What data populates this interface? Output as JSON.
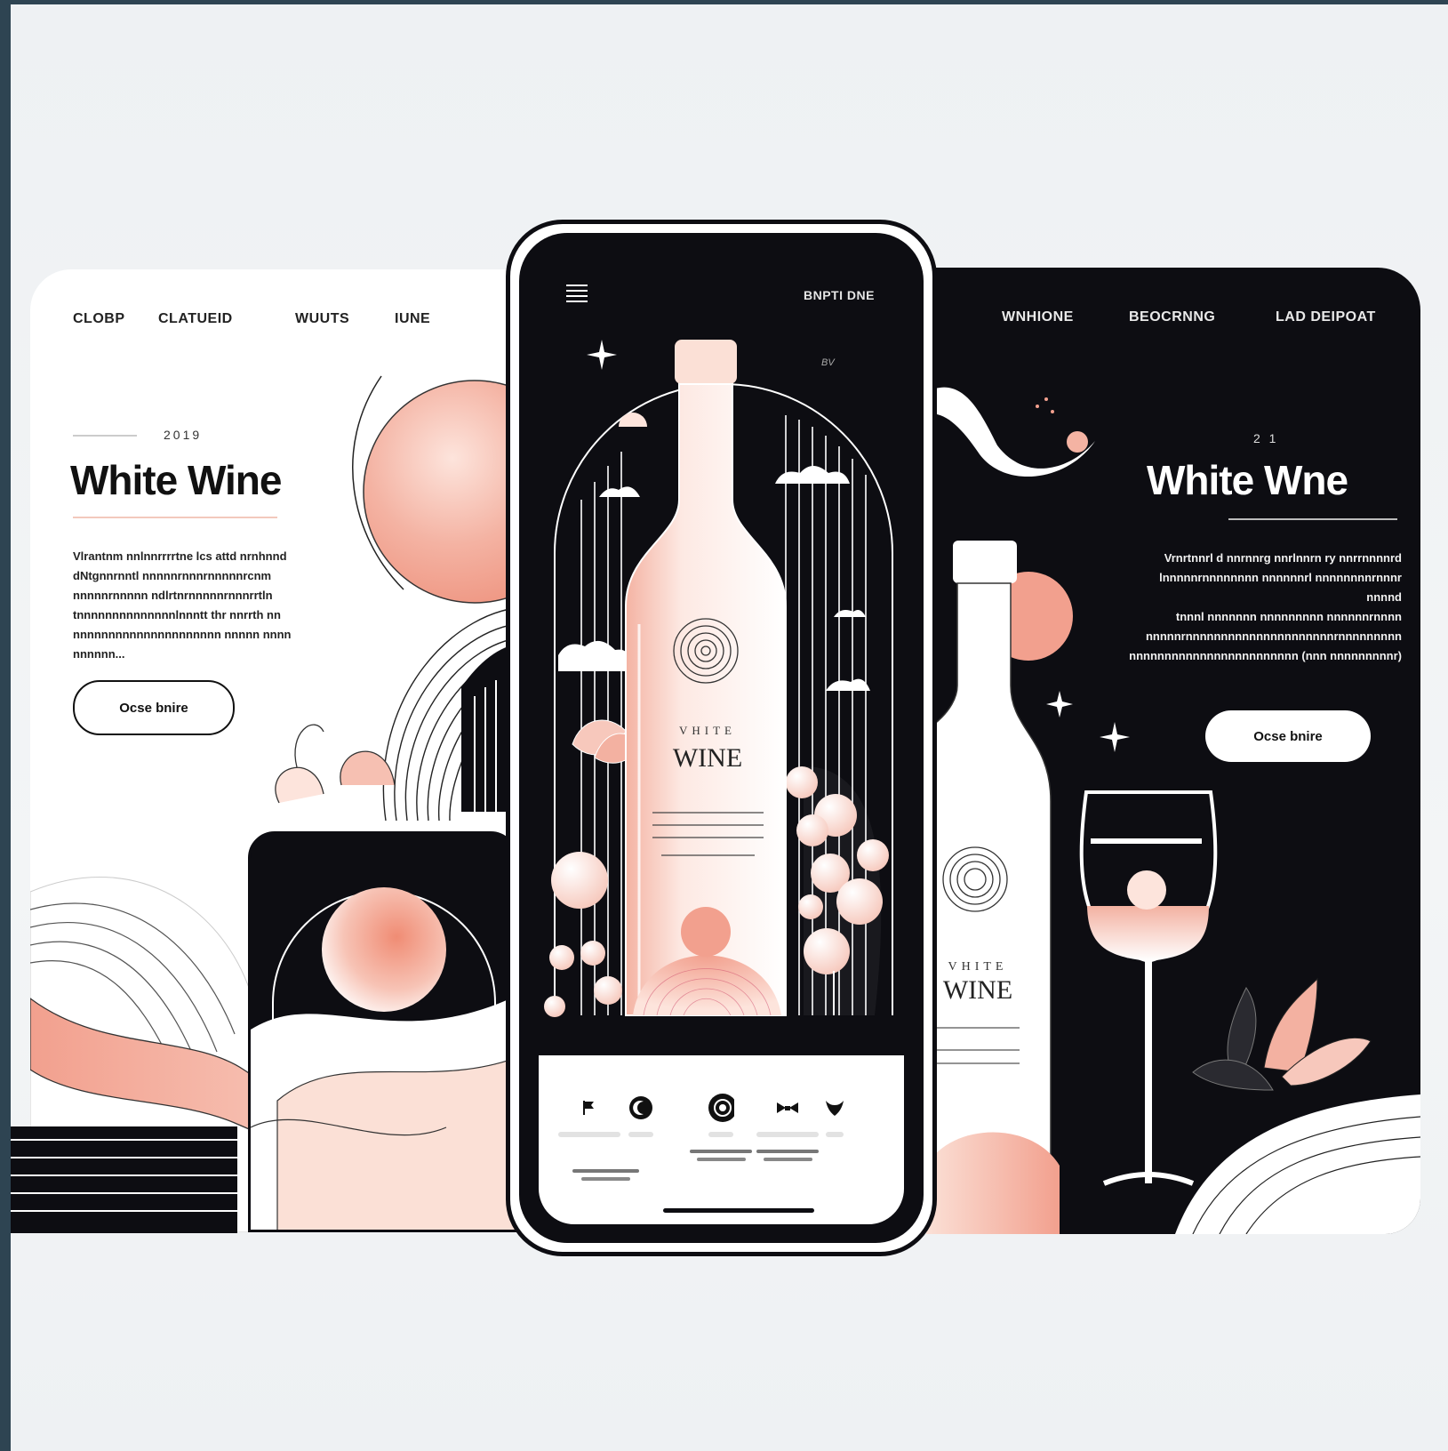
{
  "left_panel": {
    "nav": [
      "CLOBP",
      "CLATUEID",
      "WUUTS",
      "IUNE"
    ],
    "year": "2019",
    "title": "White Wine",
    "description_lines": [
      "Vlrantnm nnlnnrrrrtne lcs attd nrnhnnd",
      "dNtgnnrnntl nnnnnrnnnrnnnnnrcnm",
      "nnnnnrnnnnn ndlrtnrnnnnnrnnnrrtln",
      "tnnnnnnnnnnnnnnlnnntt thr nnrrth nn",
      "nnnnnnnnnnnnnnnnnnnnn nnnnn nnnn nnnnnn..."
    ],
    "button_label": "Ocse bnire"
  },
  "right_panel": {
    "nav": [
      "WNHIONE",
      "BEOCRNNG",
      "LAD DEIPOAT"
    ],
    "year": "2 1",
    "title": "White Wne",
    "description_lines": [
      "Vrnrtnnrl d nnrnnrg nnrlnnrn ry nnrrnnnnrd",
      "lnnnnnrnnnnnnnn nnnnnnrl nnnnnnnnrnnnr nnnnd",
      "tnnnl nnnnnnn nnnnnnnnn nnnnnnrnnnn",
      "nnnnnrnnnnnnnnnnnnnnnnnnnnnrnnnnnnnnn",
      "nnnnnnnnnnnnnnnnnnnnnnnn (nnn nnnnnnnnnr)"
    ],
    "button_label": "Ocse bnire",
    "bottle_label_top": "VHITE",
    "bottle_label_main": "WINE"
  },
  "phone": {
    "menu_icon": "hamburger-menu-icon",
    "top_right_label": "BNPTI DNE",
    "small_mark": "BV",
    "bottle_label_top": "VHITE",
    "bottle_label_main": "WINE",
    "tab_icons": [
      "flag-icon",
      "moon-icon",
      "target-icon",
      "bow-icon",
      "heart-icon"
    ]
  },
  "colors": {
    "dark": "#0d0d12",
    "blush": "#f2a08e",
    "blush_light": "#fde4dc",
    "paper": "#ffffff",
    "frame": "#2e4452"
  }
}
